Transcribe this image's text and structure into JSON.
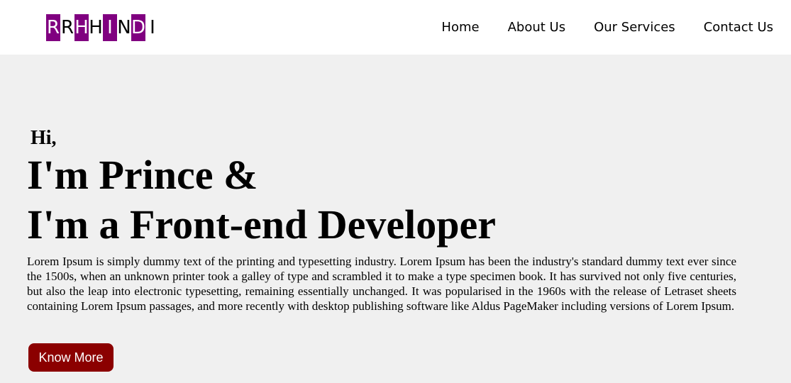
{
  "logo": {
    "letters": [
      {
        "char": "R",
        "filled": true
      },
      {
        "char": "R",
        "filled": false
      },
      {
        "char": "H",
        "filled": true
      },
      {
        "char": "H",
        "filled": false
      },
      {
        "char": "I",
        "filled": true
      },
      {
        "char": "N",
        "filled": false
      },
      {
        "char": "D",
        "filled": true
      },
      {
        "char": "I",
        "filled": false
      }
    ],
    "accent_color": "#800080"
  },
  "nav": {
    "home": "Home",
    "about": "About Us",
    "services": "Our Services",
    "contact": "Contact Us"
  },
  "hero": {
    "greeting": "Hi,",
    "line1": "I'm Prince &",
    "line2": "I'm a Front-end Developer",
    "bio": "Lorem Ipsum is simply dummy text of the printing and typesetting industry. Lorem Ipsum has been the industry's standard dummy text ever since the 1500s, when an unknown printer took a galley of type and scrambled it to make a type specimen book. It has survived not only five centuries, but also the leap into electronic typesetting, remaining essentially unchanged. It was popularised in the 1960s with the release of Letraset sheets containing Lorem Ipsum passages, and more recently with desktop publishing software like Aldus PageMaker including versions of Lorem Ipsum.",
    "button_label": "Know More",
    "button_color": "#8b0000"
  }
}
